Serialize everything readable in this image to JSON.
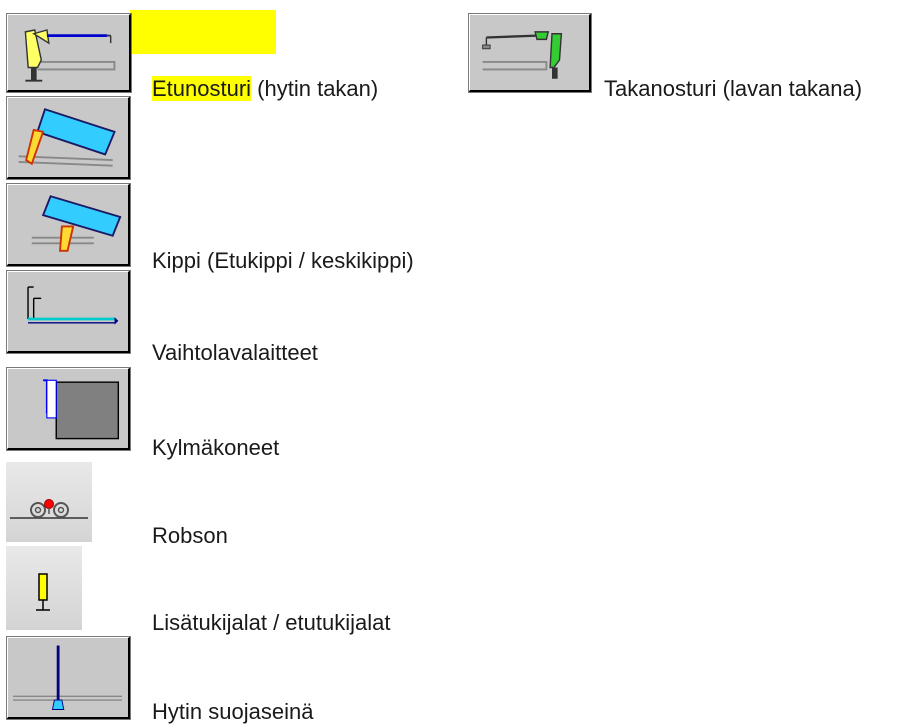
{
  "highlight_color": "#ffff00",
  "items": [
    {
      "id": "etunosturi",
      "label_highlighted": "Etunosturi",
      "label_rest": " (hytin takan)",
      "icon": "front-crane-icon"
    },
    {
      "id": "takanosturi",
      "label": "Takanosturi (lavan takana)",
      "icon": "rear-crane-icon"
    },
    {
      "id": "etukippi",
      "label": "",
      "icon": "front-tipper-icon"
    },
    {
      "id": "kippi",
      "label": "Kippi (Etukippi / keskikippi)",
      "icon": "middle-tipper-icon"
    },
    {
      "id": "vaihtolava",
      "label": "Vaihtolavalaitteet",
      "icon": "hooklift-icon"
    },
    {
      "id": "kylmakone",
      "label": "Kylmäkoneet",
      "icon": "refrigeration-unit-icon"
    },
    {
      "id": "robson",
      "label": "Robson",
      "icon": "robson-drive-icon"
    },
    {
      "id": "tukijalat",
      "label": "Lisätukijalat / etutukijalat",
      "icon": "outrigger-icon"
    },
    {
      "id": "suojaseina",
      "label": "Hytin suojaseinä",
      "icon": "cab-guard-icon"
    }
  ]
}
